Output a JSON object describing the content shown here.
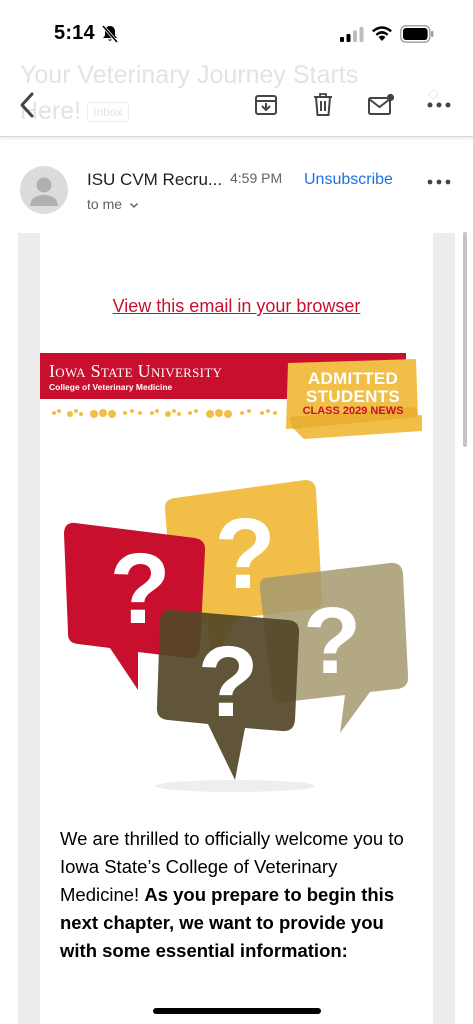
{
  "status_bar": {
    "time": "5:14",
    "icons": [
      "bell-slash-icon",
      "cellular-signal-icon",
      "wifi-icon",
      "battery-icon"
    ]
  },
  "toolbar": {
    "subject_faded": "Your Veterinary Journey Starts Here!",
    "inbox_label": "Inbox",
    "icons": [
      "back-icon",
      "archive-icon",
      "trash-icon",
      "mark-unread-icon",
      "more-icon"
    ]
  },
  "sender": {
    "name": "ISU CVM Recru...",
    "time": "4:59 PM",
    "to": "to me",
    "unsubscribe_label": "Unsubscribe"
  },
  "email": {
    "browser_link": "View this email in your browser",
    "banner": {
      "university": "Iowa State University",
      "college": "College of Veterinary Medicine",
      "badge_line1": "ADMITTED",
      "badge_line2": "STUDENTS",
      "badge_line3": "CLASS 2029 NEWS"
    },
    "intro_plain": "We are thrilled to officially welcome you to Iowa State’s College of Veterinary Medicine!",
    "intro_bold": "As you prepare to begin this next chapter, we want to provide you with some essential information:"
  },
  "colors": {
    "isu_red": "#c8102e",
    "isu_gold": "#f1be48",
    "link_blue": "#1a73e8"
  }
}
